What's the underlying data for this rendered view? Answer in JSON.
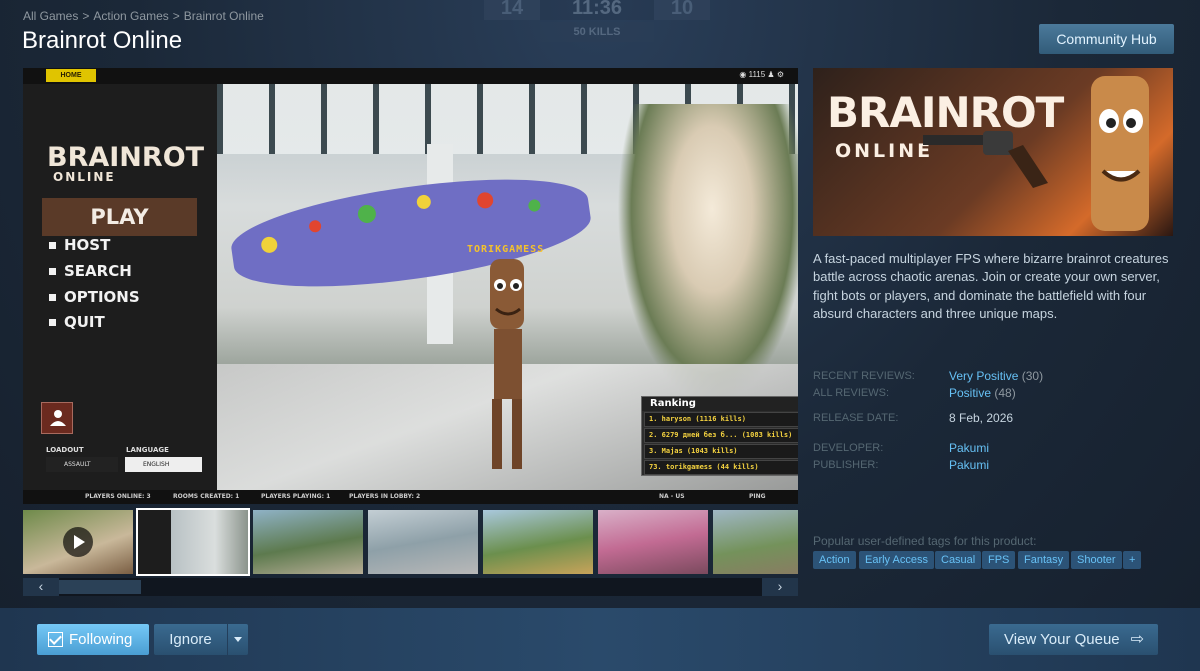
{
  "breadcrumb": {
    "items": [
      "All Games",
      "Action Games",
      "Brainrot Online"
    ],
    "separator": ">"
  },
  "page_title": "Brainrot Online",
  "community_hub_label": "Community Hub",
  "overlay_scoreboard": {
    "left_score": "14",
    "clock": "11:36",
    "right_score": "10",
    "kills_goal": "50 KILLS"
  },
  "game_screen": {
    "home_tab": "HOME",
    "top_icons_count": "1115",
    "logo_line1": "BRAINROT",
    "logo_line2": "ONLINE",
    "play_label": "PLAY",
    "menu_items": [
      "HOST",
      "SEARCH",
      "OPTIONS",
      "QUIT"
    ],
    "loadout_label": "LOADOUT",
    "loadout_value": "ASSAULT",
    "language_label": "LANGUAGE",
    "language_value": "ENGLISH",
    "player_tag": "TORIKGAMESS",
    "status": {
      "players_online": "PLAYERS ONLINE: 3",
      "rooms_created": "ROOMS CREATED: 1",
      "players_playing": "PLAYERS PLAYING: 1",
      "players_in_lobby": "PLAYERS IN LOBBY: 2",
      "region": "NA - US",
      "ping": "PING"
    },
    "ranking": {
      "title": "Ranking",
      "rows": [
        "1.   haryson   (1116 kills)",
        "2. 6279 дней без б... (1083 kills)",
        "3.   Majas   (1043 kills)",
        "73. torikgamess (44 kills)"
      ]
    }
  },
  "thumbnails": {
    "count": 7,
    "selected_index": 1
  },
  "scroll": {
    "left": "‹",
    "right": "›"
  },
  "capsule": {
    "title": "BRAINROT",
    "subtitle": "ONLINE"
  },
  "description": "A fast-paced multiplayer FPS where bizarre brainrot creatures battle across chaotic arenas. Join or create your own server, fight bots or players, and dominate the battlefield with four absurd characters and three unique maps.",
  "reviews": {
    "recent_label": "RECENT REVIEWS:",
    "recent_value": "Very Positive",
    "recent_count": "(30)",
    "all_label": "ALL REVIEWS:",
    "all_value": "Positive",
    "all_count": "(48)"
  },
  "release": {
    "label": "RELEASE DATE:",
    "value": "8 Feb, 2026"
  },
  "developer": {
    "label": "DEVELOPER:",
    "value": "Pakumi"
  },
  "publisher": {
    "label": "PUBLISHER:",
    "value": "Pakumi"
  },
  "tags_label": "Popular user-defined tags for this product:",
  "tags": [
    "Action",
    "Early Access",
    "Casual",
    "FPS",
    "Fantasy",
    "Shooter",
    "+"
  ],
  "actions": {
    "following": "Following",
    "ignore": "Ignore",
    "view_queue": "View Your Queue"
  },
  "colors": {
    "accent": "#66c0f4",
    "background": "#1b2838",
    "tag_bg": "#2c5377"
  }
}
